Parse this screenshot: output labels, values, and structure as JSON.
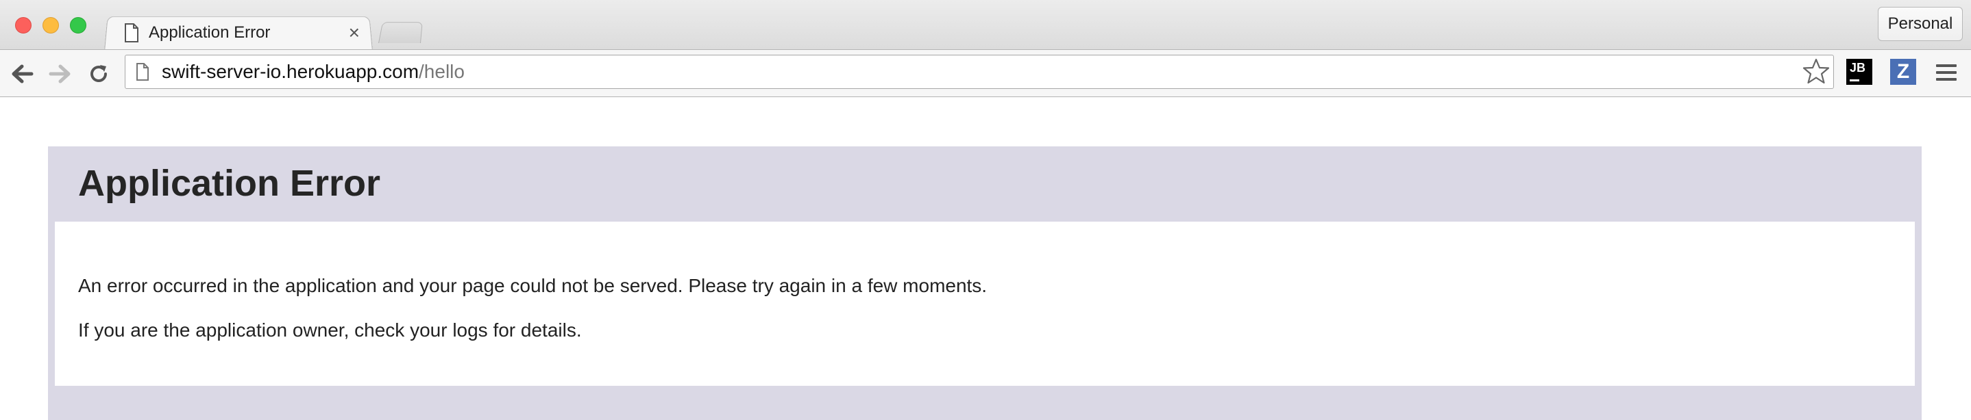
{
  "browser": {
    "tab": {
      "title": "Application Error"
    },
    "profile": {
      "label": "Personal"
    },
    "address_bar": {
      "host": "swift-server-io.herokuapp.com",
      "path": "/hello"
    },
    "extensions": [
      {
        "name": "jetbrains-extension",
        "label": "JB"
      },
      {
        "name": "z-extension",
        "label": "Z"
      }
    ]
  },
  "page": {
    "heading": "Application Error",
    "messages": [
      "An error occurred in the application and your page could not be served. Please try again in a few moments.",
      "If you are the application owner, check your logs for details."
    ],
    "colors": {
      "box_background": "#dad8e5",
      "heading_text": "#252525"
    }
  }
}
